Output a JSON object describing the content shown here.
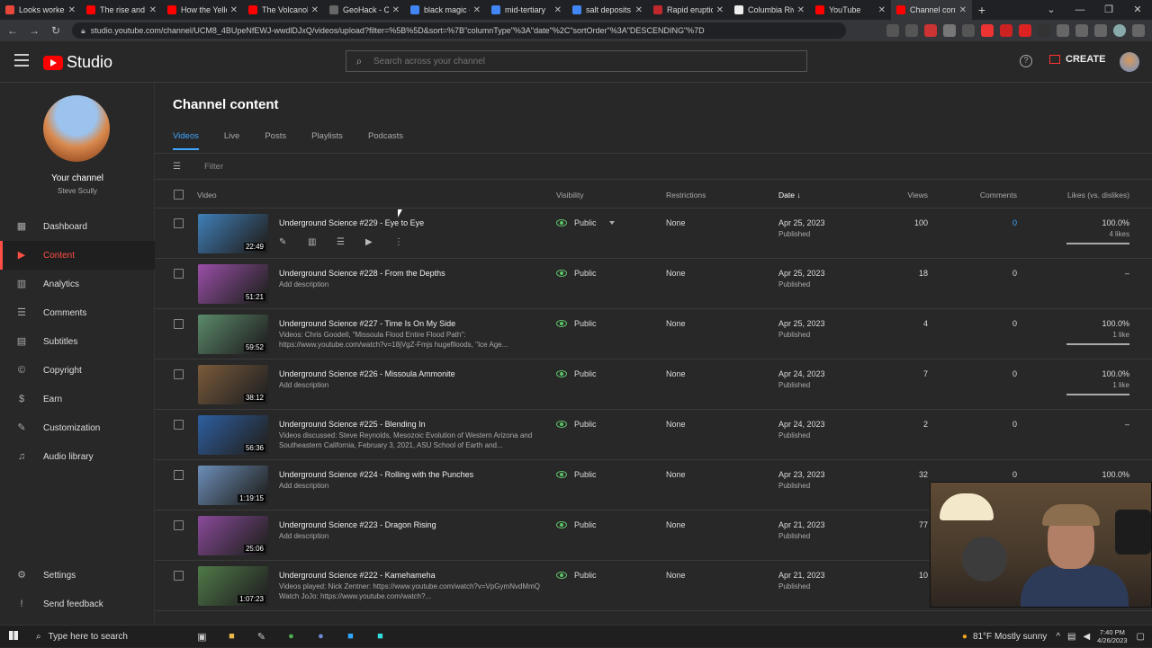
{
  "browser": {
    "tabs": [
      {
        "label": "Looks worke",
        "color": "#e8473c"
      },
      {
        "label": "The rise and f",
        "color": "#ff0000"
      },
      {
        "label": "How the Yello",
        "color": "#ff0000"
      },
      {
        "label": "The Volcanol",
        "color": "#ff0000"
      },
      {
        "label": "GeoHack - Co",
        "color": "#666666"
      },
      {
        "label": "black magic -",
        "color": "#4285f4"
      },
      {
        "label": "mid-tertiary",
        "color": "#4285f4"
      },
      {
        "label": "salt deposits",
        "color": "#4285f4"
      },
      {
        "label": "Rapid eruptio",
        "color": "#c0282d"
      },
      {
        "label": "Columbia Riv",
        "color": "#eeeeee"
      },
      {
        "label": "YouTube",
        "color": "#ff0000"
      },
      {
        "label": "Channel cont",
        "color": "#ff0000",
        "active": true
      }
    ],
    "url": "studio.youtube.com/channel/UCM8_4BUpeNfEWJ-wwdlDJxQ/videos/upload?filter=%5B%5D&sort=%7B\"columnType\"%3A\"date\"%2C\"sortOrder\"%3A\"DESCENDING\"%7D"
  },
  "studio": {
    "logo_text": "Studio",
    "search_placeholder": "Search across your channel",
    "create_label": "CREATE"
  },
  "sidebar": {
    "channel_title": "Your channel",
    "channel_name": "Steve Scully",
    "items": [
      {
        "label": "Dashboard",
        "icon": "▦"
      },
      {
        "label": "Content",
        "icon": "▶",
        "active": true
      },
      {
        "label": "Analytics",
        "icon": "▥"
      },
      {
        "label": "Comments",
        "icon": "☰"
      },
      {
        "label": "Subtitles",
        "icon": "▤"
      },
      {
        "label": "Copyright",
        "icon": "©"
      },
      {
        "label": "Earn",
        "icon": "$"
      },
      {
        "label": "Customization",
        "icon": "✎"
      },
      {
        "label": "Audio library",
        "icon": "♫"
      }
    ],
    "bottom_items": [
      {
        "label": "Settings",
        "icon": "⚙"
      },
      {
        "label": "Send feedback",
        "icon": "!"
      }
    ]
  },
  "content": {
    "title": "Channel content",
    "tabs": [
      "Videos",
      "Live",
      "Posts",
      "Playlists",
      "Podcasts"
    ],
    "filter_placeholder": "Filter",
    "columns": {
      "video": "Video",
      "visibility": "Visibility",
      "restrictions": "Restrictions",
      "date": "Date",
      "views": "Views",
      "comments": "Comments",
      "likes": "Likes (vs. dislikes)"
    },
    "rows": [
      {
        "title": "Underground Science #229 - Eye to Eye",
        "description": "",
        "duration": "22:49",
        "visibility": "Public",
        "restrictions": "None",
        "date": "Apr 25, 2023",
        "status": "Published",
        "views": "100",
        "comments": "0",
        "likes": "100.0%",
        "likes_sub": "4 likes",
        "thumb": "#3f7fb8",
        "like_fraction": 1.0,
        "hovered": true
      },
      {
        "title": "Underground Science #228 - From the Depths",
        "description": "Add description",
        "duration": "51:21",
        "visibility": "Public",
        "restrictions": "None",
        "date": "Apr 25, 2023",
        "status": "Published",
        "views": "18",
        "comments": "0",
        "likes": "–",
        "likes_sub": "",
        "thumb": "#9a4fa8"
      },
      {
        "title": "Underground Science #227 - Time Is On My Side",
        "description": "Videos: Chris Goodell, \"Missoula Flood Entire Flood Path\": https://www.youtube.com/watch?v=18jVgZ-Fmjs hugeflloods, \"Ice Age...",
        "duration": "59:52",
        "visibility": "Public",
        "restrictions": "None",
        "date": "Apr 25, 2023",
        "status": "Published",
        "views": "4",
        "comments": "0",
        "likes": "100.0%",
        "likes_sub": "1 like",
        "thumb": "#5b8a6a",
        "like_fraction": 1.0
      },
      {
        "title": "Underground Science #226 - Missoula Ammonite",
        "description": "Add description",
        "duration": "38:12",
        "visibility": "Public",
        "restrictions": "None",
        "date": "Apr 24, 2023",
        "status": "Published",
        "views": "7",
        "comments": "0",
        "likes": "100.0%",
        "likes_sub": "1 like",
        "thumb": "#7a5a3a",
        "like_fraction": 1.0
      },
      {
        "title": "Underground Science #225 - Blending In",
        "description": "Videos discussed: Steve Reynolds, Mesozoic Evolution of Western Arizona and Southeastern California, February 3, 2021, ASU School of Earth and...",
        "duration": "56:36",
        "visibility": "Public",
        "restrictions": "None",
        "date": "Apr 24, 2023",
        "status": "Published",
        "views": "2",
        "comments": "0",
        "likes": "–",
        "likes_sub": "",
        "thumb": "#2d5fa0"
      },
      {
        "title": "Underground Science #224 - Rolling with the Punches",
        "description": "Add description",
        "duration": "1:19:15",
        "visibility": "Public",
        "restrictions": "None",
        "date": "Apr 23, 2023",
        "status": "Published",
        "views": "32",
        "comments": "0",
        "likes": "100.0%",
        "likes_sub": "",
        "thumb": "#6c8fb8"
      },
      {
        "title": "Underground Science #223 - Dragon Rising",
        "description": "Add description",
        "duration": "25:06",
        "visibility": "Public",
        "restrictions": "None",
        "date": "Apr 21, 2023",
        "status": "Published",
        "views": "77",
        "comments": "",
        "likes": "",
        "likes_sub": "",
        "thumb": "#8a4a9a"
      },
      {
        "title": "Underground Science #222 - Kamehameha",
        "description": "Videos played: Nick Zentner: https://www.youtube.com/watch?v=VpGymNvdMmQ Watch JoJo: https://www.youtube.com/watch?...",
        "duration": "1:07:23",
        "visibility": "Public",
        "restrictions": "None",
        "date": "Apr 21, 2023",
        "status": "Published",
        "views": "10",
        "comments": "",
        "likes": "",
        "likes_sub": "",
        "thumb": "#4f7a48"
      }
    ]
  },
  "taskbar": {
    "search_placeholder": "Type here to search",
    "weather": "81°F  Mostly sunny",
    "time": "7:40 PM",
    "date": "4/26/2023"
  }
}
